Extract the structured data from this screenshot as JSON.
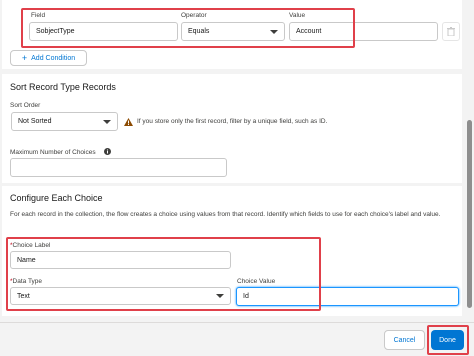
{
  "filter": {
    "field_label": "Field",
    "operator_label": "Operator",
    "value_label": "Value",
    "field_value": "SobjectType",
    "operator_value": "Equals",
    "value_value": "Account",
    "add_condition": "Add Condition",
    "icons": {
      "delete": "trash-icon",
      "add": "plus-icon"
    }
  },
  "sort": {
    "title": "Sort Record Type Records",
    "order_label": "Sort Order",
    "order_value": "Not Sorted",
    "hint": "If you store only the first record, filter by a unique field, such as ID.",
    "max_label": "Maximum Number of Choices",
    "max_value": ""
  },
  "choice": {
    "title": "Configure Each Choice",
    "description": "For each record in the collection, the flow creates a choice using values from that record. Identify which fields to use for each choice's label and value.",
    "label_label": "Choice Label",
    "label_value": "Name",
    "type_label": "Data Type",
    "type_value": "Text",
    "value_label": "Choice Value",
    "value_value": "Id"
  },
  "footer": {
    "cancel": "Cancel",
    "done": "Done"
  },
  "colors": {
    "brand": "#0176d3",
    "highlight": "#e0404a",
    "warning": "#8c4b02"
  }
}
